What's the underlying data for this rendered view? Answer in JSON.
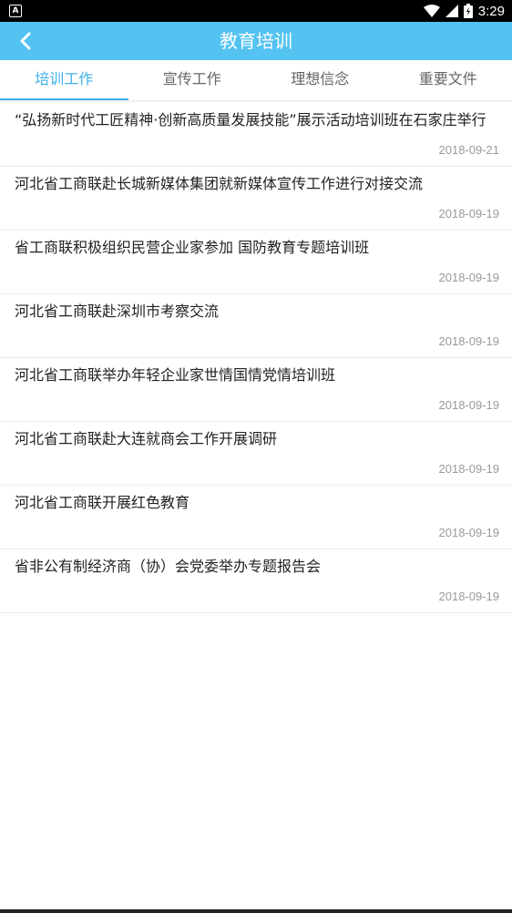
{
  "status_bar": {
    "app_icon": "A",
    "time": "3:29"
  },
  "header": {
    "title": "教育培训"
  },
  "tabs": [
    {
      "label": "培训工作",
      "active": true
    },
    {
      "label": "宣传工作",
      "active": false
    },
    {
      "label": "理想信念",
      "active": false
    },
    {
      "label": "重要文件",
      "active": false
    }
  ],
  "articles": [
    {
      "title": "“弘扬新时代工匠精神·创新高质量发展技能”展示活动培训班在石家庄举行",
      "date": "2018-09-21"
    },
    {
      "title": "河北省工商联赴长城新媒体集团就新媒体宣传工作进行对接交流",
      "date": "2018-09-19"
    },
    {
      "title": "省工商联积极组织民营企业家参加 国防教育专题培训班",
      "date": "2018-09-19"
    },
    {
      "title": "河北省工商联赴深圳市考察交流",
      "date": "2018-09-19"
    },
    {
      "title": "河北省工商联举办年轻企业家世情国情党情培训班",
      "date": "2018-09-19"
    },
    {
      "title": "河北省工商联赴大连就商会工作开展调研",
      "date": "2018-09-19"
    },
    {
      "title": "河北省工商联开展红色教育",
      "date": "2018-09-19"
    },
    {
      "title": "省非公有制经济商（协）会党委举办专题报告会",
      "date": "2018-09-19"
    }
  ],
  "colors": {
    "header_bg": "#54c3f1",
    "tab_active": "#3fb1e8"
  }
}
